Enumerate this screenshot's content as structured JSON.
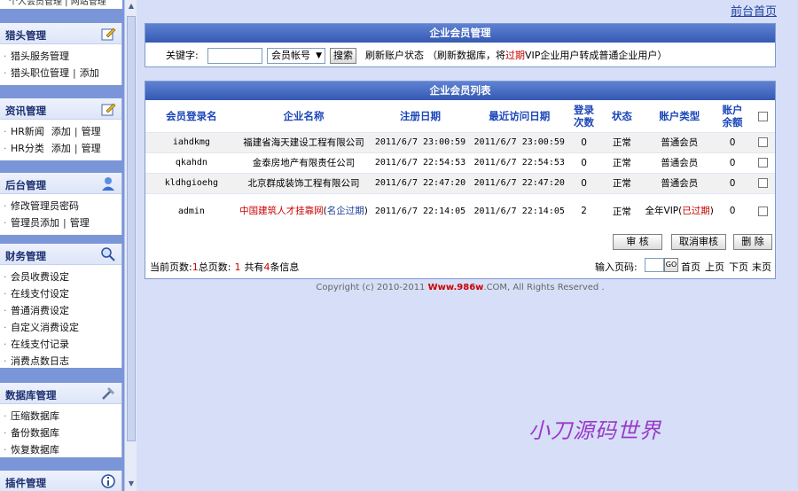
{
  "sidebar": {
    "top_strip": "个人会员管理 | 网站管理",
    "blocks": [
      {
        "title": "猎头管理",
        "icon": "edit-icon",
        "items": [
          [
            "猎头服务管理"
          ],
          [
            "猎头职位管理",
            "添加"
          ]
        ]
      },
      {
        "title": "资讯管理",
        "icon": "edit-icon",
        "items": [
          [
            "HR新闻",
            "添加",
            "管理"
          ],
          [
            "HR分类",
            "添加",
            "管理"
          ]
        ]
      },
      {
        "title": "后台管理",
        "icon": "user-icon",
        "items": [
          [
            "修改管理员密码"
          ],
          [
            "管理员添加",
            "管理"
          ]
        ]
      },
      {
        "title": "财务管理",
        "icon": "search-icon",
        "items": [
          [
            "会员收费设定"
          ],
          [
            "在线支付设定"
          ],
          [
            "普通消费设定"
          ],
          [
            "自定义消费设定"
          ],
          [
            "在线支付记录"
          ],
          [
            "消费点数日志"
          ]
        ]
      },
      {
        "title": "数据库管理",
        "icon": "tools-icon",
        "items": [
          [
            "压缩数据库"
          ],
          [
            "备份数据库"
          ],
          [
            "恢复数据库"
          ]
        ]
      },
      {
        "title": "插件管理",
        "icon": "info-icon",
        "items": []
      }
    ]
  },
  "header": {
    "home_link": "前台首页"
  },
  "search_panel": {
    "title": "企业会员管理",
    "keyword_label": "关键字:",
    "keyword_value": "",
    "field_select": "会员帐号",
    "search_button": "搜索",
    "refresh_label": "刷新账户状态",
    "refresh_note_pre": "（刷新数据库，将",
    "refresh_note_red": "过期",
    "refresh_note_post": "VIP企业用户转成普通企业用户）"
  },
  "list_panel": {
    "title": "企业会员列表",
    "columns": [
      "会员登录名",
      "企业名称",
      "注册日期",
      "最近访问日期",
      "登录次数",
      "状态",
      "账户类型",
      "账户余额"
    ],
    "rows": [
      {
        "login": "iahdkmg",
        "company": "福建省海天建设工程有限公司",
        "reg": "2011/6/7 23:00:59",
        "last": "2011/6/7 23:00:59",
        "logins": "0",
        "status": "正常",
        "type": "普通会员",
        "balance": "0"
      },
      {
        "login": "qkahdn",
        "company": "金泰房地产有限责任公司",
        "reg": "2011/6/7 22:54:53",
        "last": "2011/6/7 22:54:53",
        "logins": "0",
        "status": "正常",
        "type": "普通会员",
        "balance": "0"
      },
      {
        "login": "kldhgioehg",
        "company": "北京群成装饰工程有限公司",
        "reg": "2011/6/7 22:47:20",
        "last": "2011/6/7 22:47:20",
        "logins": "0",
        "status": "正常",
        "type": "普通会员",
        "balance": "0"
      },
      {
        "login": "admin",
        "company": "中国建筑人才挂靠网",
        "company_note_pre": "(",
        "company_note": "名企过期",
        "company_note_post": ")",
        "reg": "2011/6/7 22:14:05",
        "last": "2011/6/7 22:14:05",
        "logins": "2",
        "status": "正常",
        "type": "全年VIP",
        "type_note_pre": "(",
        "type_note": "已过期",
        "type_note_post": ")",
        "balance": "0"
      }
    ],
    "actions": {
      "approve": "审  核",
      "cancel": "取消审核",
      "delete": "删  除"
    },
    "pager": {
      "current_label": "当前页数:",
      "current": "1",
      "total_label": "总页数:",
      "total": "1",
      "count_pre": "共有",
      "count": "4",
      "count_post": "条信息",
      "input_label": "输入页码:",
      "go": "GO",
      "first": "首页",
      "prev": "上页",
      "next": "下页",
      "last": "末页"
    }
  },
  "footer": {
    "copyright_pre": "Copyright (c) 2010-2011 ",
    "brand": "Www.986w",
    "copyright_post": ".COM, All Rights Reserved ."
  },
  "watermark": "小刀源码世界",
  "colors": {
    "background": "#d6dff7",
    "panel_header": "#3559b3",
    "header_text": "#1b46b8",
    "alert": "#cc0000"
  }
}
